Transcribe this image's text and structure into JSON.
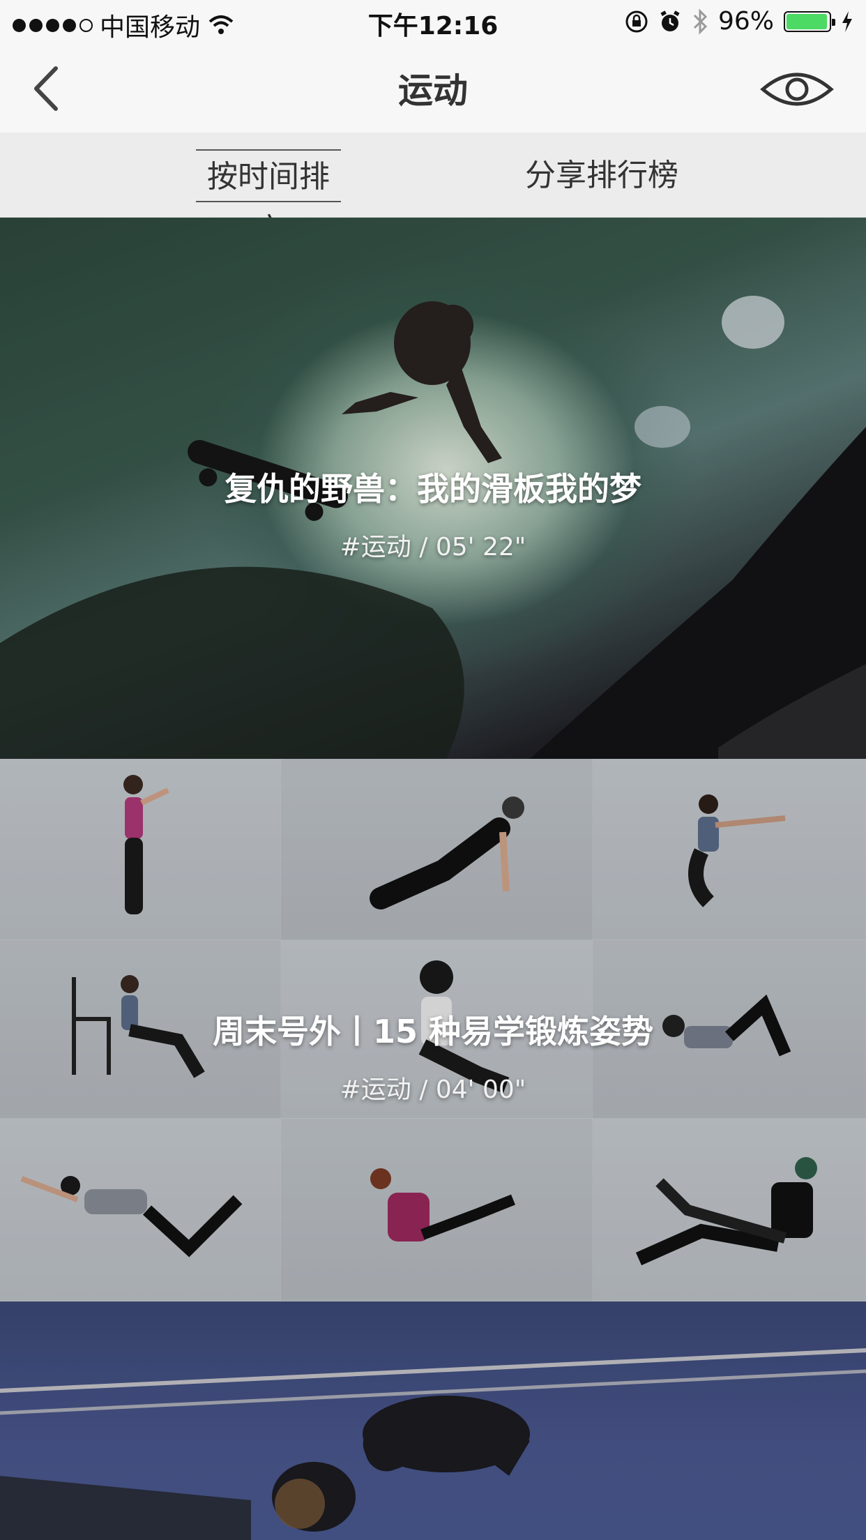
{
  "status_bar": {
    "carrier": "中国移动",
    "time": "下午12:16",
    "battery_percent": "96%",
    "battery_level": 0.96,
    "icons": [
      "signal-dots",
      "wifi-icon",
      "rotation-lock-icon",
      "alarm-icon",
      "bluetooth-icon",
      "battery-icon",
      "charging-bolt-icon"
    ],
    "battery_color": "#4cd964"
  },
  "nav": {
    "title": "运动",
    "left_icon": "back-chevron-icon",
    "right_icon": "eye-icon"
  },
  "tabs": [
    {
      "label": "按时间排序",
      "active": true
    },
    {
      "label": "分享排行榜",
      "active": false
    }
  ],
  "cards": [
    {
      "title": "复仇的野兽：我的滑板我的梦",
      "meta": "#运动  /  05' 22\""
    },
    {
      "title": "周末号外丨15 种易学锻炼姿势",
      "meta": "#运动  /  04' 00\""
    },
    {
      "title": "",
      "meta": ""
    }
  ]
}
